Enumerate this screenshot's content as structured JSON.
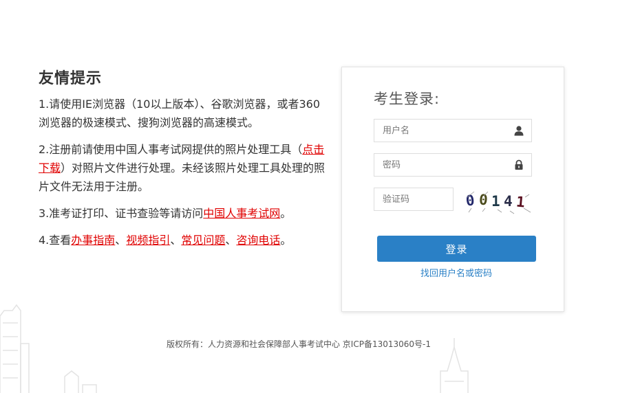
{
  "notice": {
    "title": "友情提示",
    "item1": "1.请使用IE浏览器（10以上版本）、谷歌浏览器，或者360浏览器的极速模式、搜狗浏览器的高速模式。",
    "item2_pre": "2.注册前请使用中国人事考试网提供的照片处理工具（",
    "item2_link": "点击下载",
    "item2_post": "）对照片文件进行处理。未经该照片处理工具处理的照片文件无法用于注册。",
    "item3_pre": "3.准考证打印、证书查验等请访问",
    "item3_link": "中国人事考试网",
    "item3_post": "。",
    "item4_pre": "4.查看",
    "item4_link1": "办事指南",
    "sep": "、",
    "item4_link2": "视频指引",
    "item4_link3": "常见问题",
    "item4_link4": "咨询电话",
    "item4_post": "。",
    "link_color": "#e00000"
  },
  "login": {
    "title": "考生登录:",
    "username_placeholder": "用户名",
    "password_placeholder": "密码",
    "captcha_placeholder": "验证码",
    "captcha_text": "00141",
    "submit_label": "登录",
    "forgot_label": "找回用户名或密码",
    "username_icon": "user-icon",
    "password_icon": "lock-icon",
    "button_color": "#2a80c6"
  },
  "footer": {
    "copyright": "版权所有：人力资源和社会保障部人事考试中心 京ICP备13013060号-1"
  }
}
